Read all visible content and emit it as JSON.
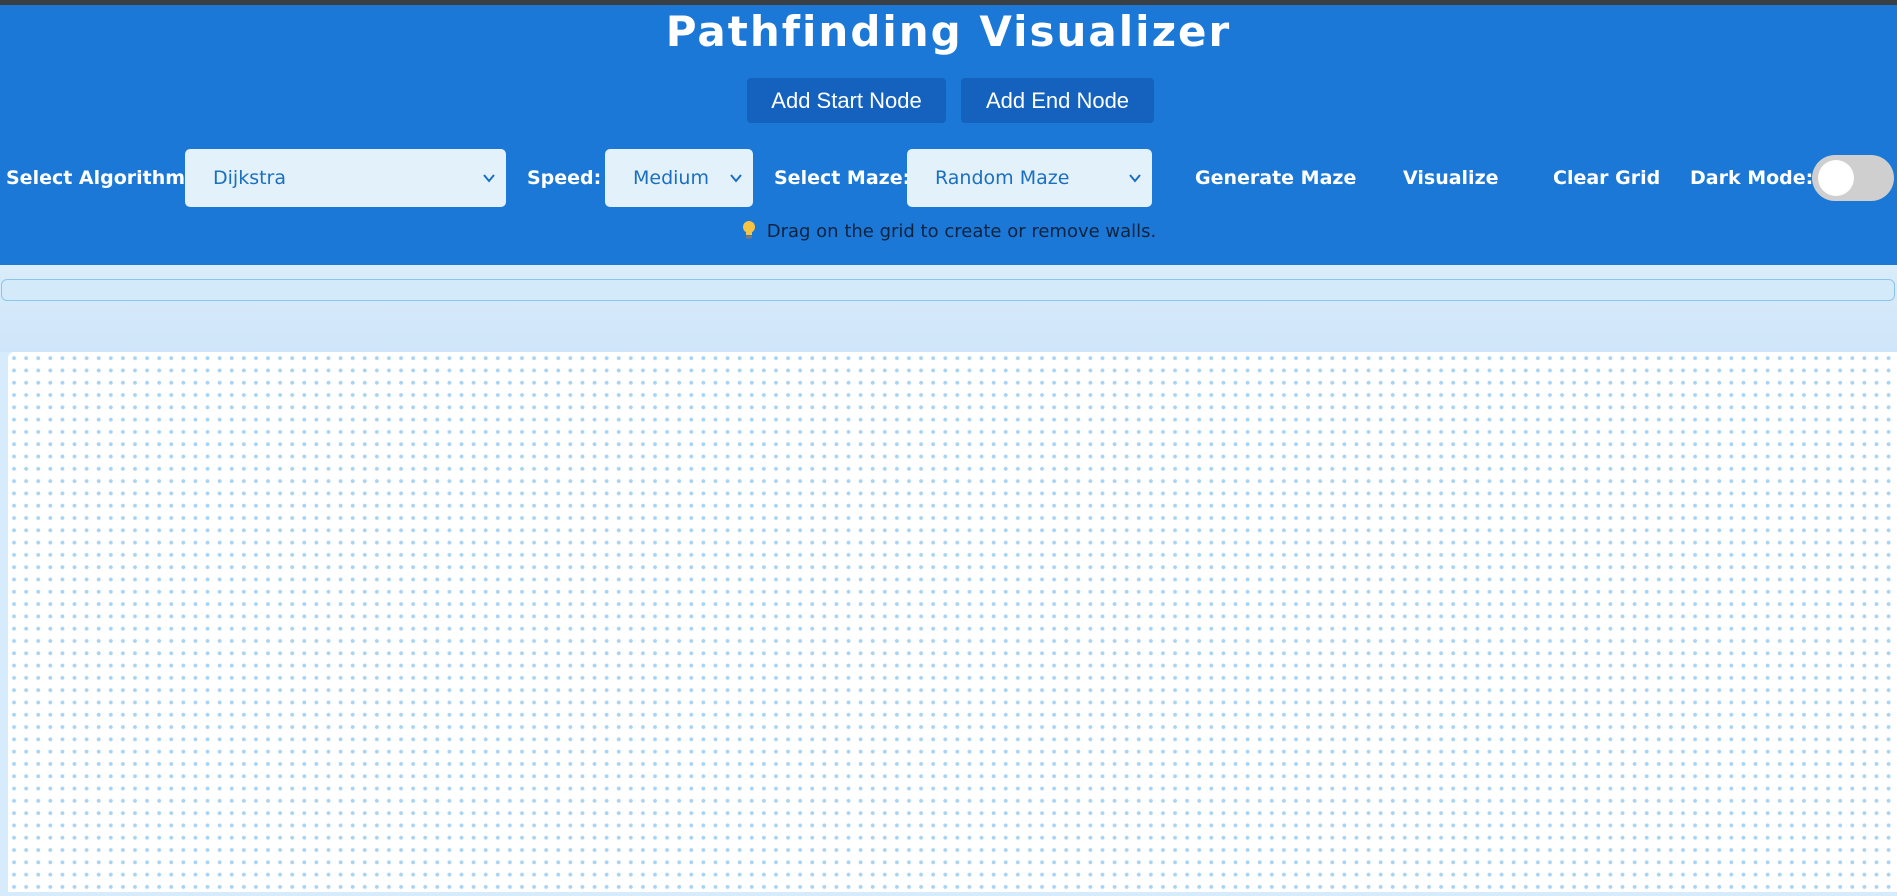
{
  "app": {
    "title": "Pathfinding Visualizer",
    "accent_color": "#1b78d6",
    "button_color": "#1462be"
  },
  "node_buttons": {
    "add_start_label": "Add Start Node",
    "add_end_label": "Add End Node"
  },
  "controls": {
    "algorithm_label": "Select Algorithm:",
    "algorithm_value": "Dijkstra",
    "speed_label": "Speed:",
    "speed_value": "Medium",
    "maze_label": "Select Maze:",
    "maze_value": "Random Maze",
    "generate_maze_label": "Generate Maze",
    "visualize_label": "Visualize",
    "clear_grid_label": "Clear Grid",
    "dark_mode_label": "Dark Mode:",
    "dark_mode_on": false
  },
  "hint": {
    "icon": "lightbulb-icon",
    "text": "Drag on the grid to create or remove walls."
  },
  "progress": {
    "fraction": 0
  }
}
